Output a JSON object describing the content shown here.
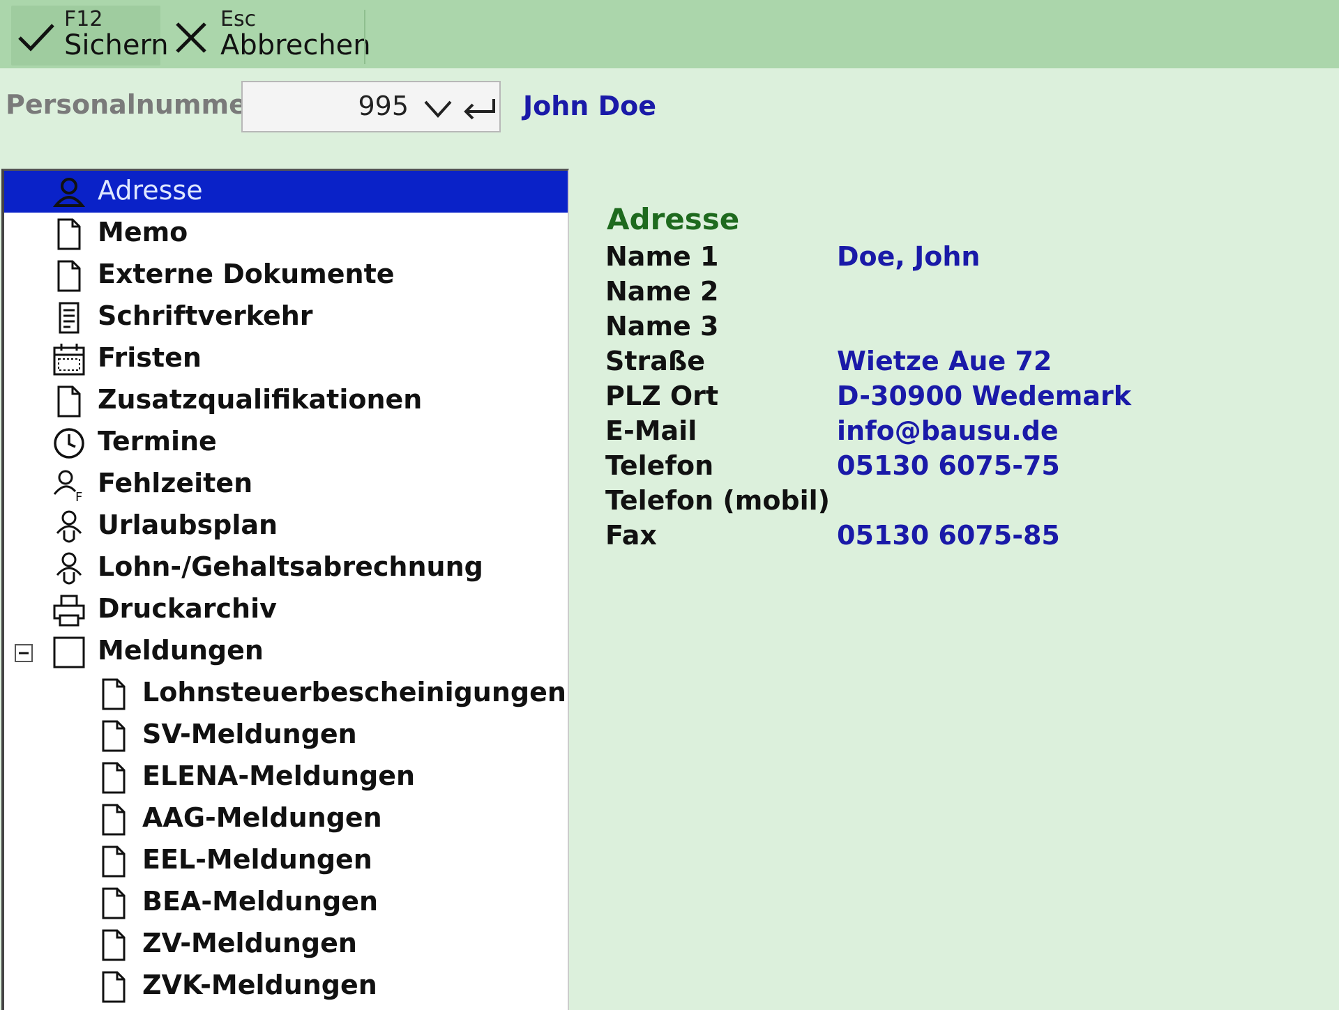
{
  "toolbar": {
    "save": {
      "key": "F12",
      "label": "Sichern"
    },
    "cancel": {
      "key": "Esc",
      "label": "Abbrechen"
    }
  },
  "personal": {
    "label": "Personalnummer",
    "value": "995",
    "name": "John Doe"
  },
  "tree": {
    "items": [
      {
        "label": "Adresse",
        "icon": "person-icon",
        "selected": true
      },
      {
        "label": "Memo",
        "icon": "document-icon"
      },
      {
        "label": "Externe Dokumente",
        "icon": "document-icon"
      },
      {
        "label": "Schriftverkehr",
        "icon": "letter-icon"
      },
      {
        "label": "Fristen",
        "icon": "calendar-icon"
      },
      {
        "label": "Zusatzqualifikationen",
        "icon": "document-icon"
      },
      {
        "label": "Termine",
        "icon": "clock-icon"
      },
      {
        "label": "Fehlzeiten",
        "icon": "person-f-icon"
      },
      {
        "label": "Urlaubsplan",
        "icon": "person-u-icon"
      },
      {
        "label": "Lohn-/Gehaltsabrechnung",
        "icon": "person-u-icon"
      },
      {
        "label": "Druckarchiv",
        "icon": "printer-icon"
      },
      {
        "label": "Meldungen",
        "icon": "folder-icon",
        "expanded": true
      },
      {
        "label": "Lohnsteuerbescheinigungen",
        "icon": "document-icon",
        "child": true
      },
      {
        "label": "SV-Meldungen",
        "icon": "document-icon",
        "child": true
      },
      {
        "label": "ELENA-Meldungen",
        "icon": "document-icon",
        "child": true
      },
      {
        "label": "AAG-Meldungen",
        "icon": "document-icon",
        "child": true
      },
      {
        "label": "EEL-Meldungen",
        "icon": "document-icon",
        "child": true
      },
      {
        "label": "BEA-Meldungen",
        "icon": "document-icon",
        "child": true
      },
      {
        "label": "ZV-Meldungen",
        "icon": "document-icon",
        "child": true
      },
      {
        "label": "ZVK-Meldungen",
        "icon": "document-icon",
        "child": true
      }
    ]
  },
  "details": {
    "title": "Adresse",
    "rows": [
      {
        "key": "Name 1",
        "value": "Doe, John"
      },
      {
        "key": "Name 2",
        "value": ""
      },
      {
        "key": "Name 3",
        "value": ""
      },
      {
        "key": "Straße",
        "value": "Wietze Aue 72"
      },
      {
        "key": "PLZ Ort",
        "value": "D-30900 Wedemark"
      },
      {
        "key": "E-Mail",
        "value": "info@bausu.de"
      },
      {
        "key": "Telefon",
        "value": "05130 6075-75"
      },
      {
        "key": "Telefon (mobil)",
        "value": ""
      },
      {
        "key": "Fax",
        "value": "05130 6075-85"
      }
    ]
  }
}
